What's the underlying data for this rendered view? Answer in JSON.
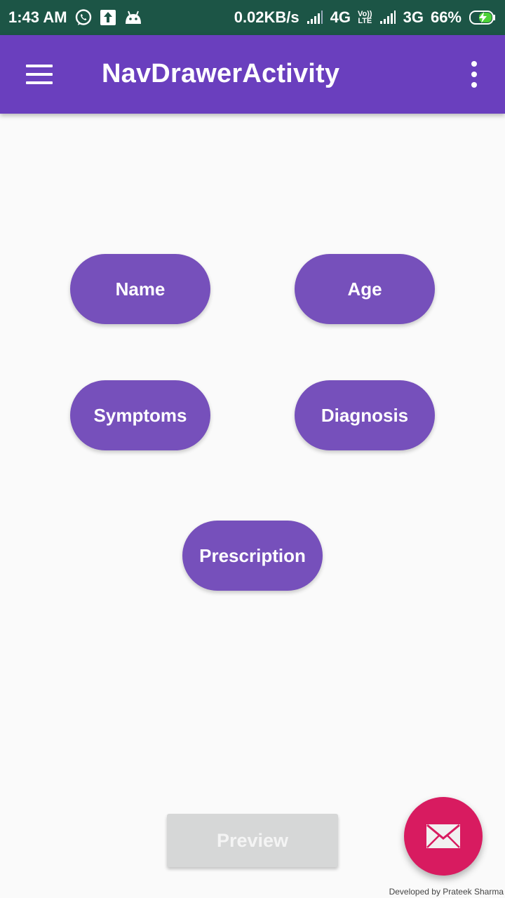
{
  "status_bar": {
    "time": "1:43 AM",
    "speed": "0.02KB/s",
    "network_1": "4G",
    "volte_top": "Vo))",
    "volte_bottom": "LTE",
    "network_2": "3G",
    "battery": "66%",
    "icons": [
      "whatsapp-icon",
      "upload-icon",
      "android-icon",
      "signal-icon",
      "signal-icon",
      "battery-charging-icon"
    ]
  },
  "app_bar": {
    "title": "NavDrawerActivity",
    "menu_icon": "hamburger-menu-icon",
    "overflow_icon": "more-vert-icon"
  },
  "buttons": {
    "name": "Name",
    "age": "Age",
    "symptoms": "Symptoms",
    "diagnosis": "Diagnosis",
    "prescription": "Prescription"
  },
  "preview": {
    "label": "Preview"
  },
  "fab": {
    "icon": "mail-icon"
  },
  "footer": {
    "credit": "Developed by Prateek Sharma"
  },
  "colors": {
    "status_bar": "#1c5546",
    "app_bar": "#6a3fbe",
    "pill_button": "#7650bb",
    "preview_disabled": "#d6d7d7",
    "fab": "#d81b60",
    "background": "#fafafa"
  }
}
